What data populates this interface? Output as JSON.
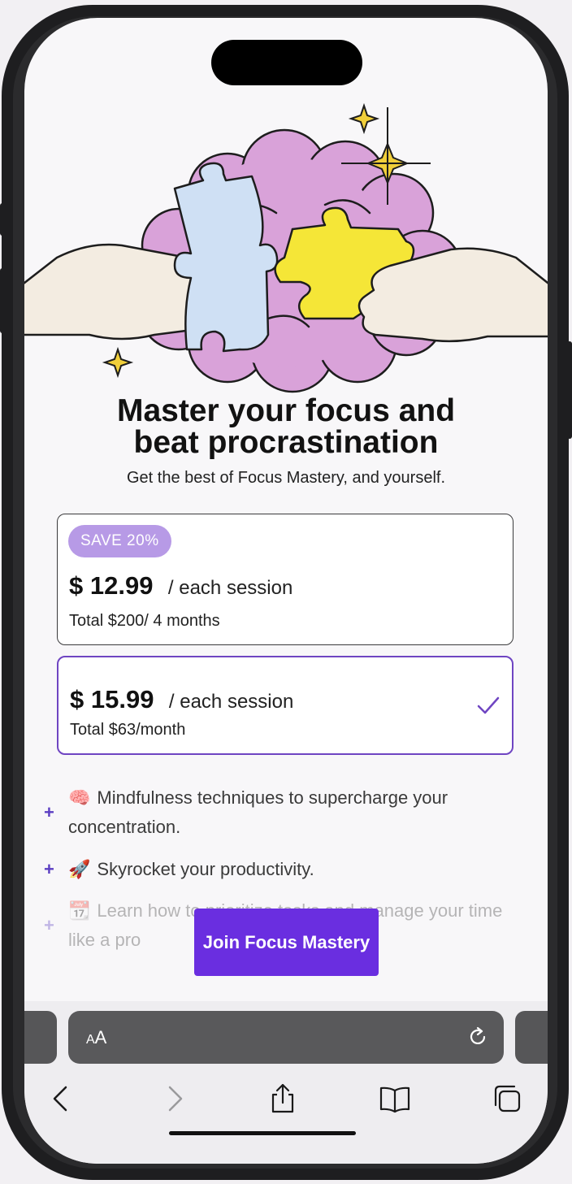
{
  "hero": {
    "illustration": "brain-puzzle-illustration"
  },
  "headline": {
    "line1": "Master your focus and",
    "line2": "beat procrastination"
  },
  "subtitle": "Get the best of Focus Mastery, and yourself.",
  "plans": [
    {
      "badge": "SAVE  20%",
      "price": "$ 12.99",
      "per": "/ each session",
      "total": "Total $200/ 4 months",
      "selected": false
    },
    {
      "price": "$ 15.99",
      "per": "/ each session",
      "total": "Total $63/month",
      "selected": true
    }
  ],
  "features": [
    {
      "emoji": "🧠",
      "text": "Mindfulness techniques to supercharge your concentration."
    },
    {
      "emoji": "🚀",
      "text": "Skyrocket your productivity."
    },
    {
      "emoji": "📆",
      "text": "Learn how to prioritize tasks and manage your time like a pro"
    }
  ],
  "cta": "Join Focus Mastery",
  "browser": {
    "aa_label_small": "A",
    "aa_label": "A",
    "icons": [
      "reload-icon",
      "back-icon",
      "forward-icon",
      "share-icon",
      "bookmarks-icon",
      "tabs-icon"
    ]
  },
  "colors": {
    "accent": "#6a2ee0",
    "selected_border": "#6f45c2",
    "badge": "#b79ae6"
  }
}
